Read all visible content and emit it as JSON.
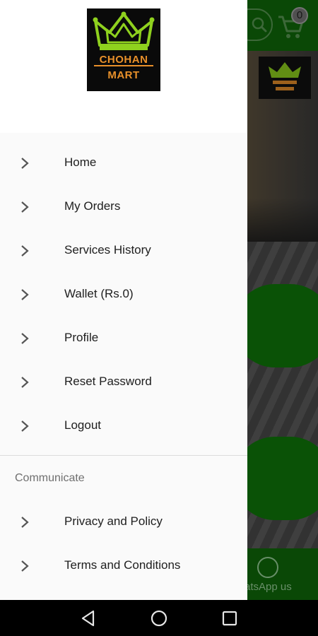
{
  "app": {
    "logo": {
      "line1": "CHOHAN",
      "line2": "MART"
    },
    "cart_count": "0"
  },
  "drawer": {
    "items": [
      {
        "label": "Home",
        "icon": "chevron-right-icon"
      },
      {
        "label": "My Orders",
        "icon": "chevron-right-icon"
      },
      {
        "label": "Services History",
        "icon": "chevron-right-icon"
      },
      {
        "label": "Wallet (Rs.0)",
        "icon": "chevron-right-icon"
      },
      {
        "label": "Profile",
        "icon": "chevron-right-icon"
      },
      {
        "label": "Reset Password",
        "icon": "chevron-right-icon"
      },
      {
        "label": "Logout",
        "icon": "chevron-right-icon"
      }
    ],
    "section_title": "Communicate",
    "communicate_items": [
      {
        "label": "Privacy and Policy",
        "icon": "chevron-right-icon"
      },
      {
        "label": "Terms and Conditions",
        "icon": "chevron-right-icon"
      }
    ]
  },
  "background": {
    "whatsapp_label": "atsApp us"
  },
  "system_nav": {
    "back_icon": "back-triangle-icon",
    "home_icon": "home-circle-icon",
    "recents_icon": "recents-square-icon"
  },
  "colors": {
    "brand_green": "#0f6b0a",
    "logo_orange": "#e8902a",
    "crown_green": "#8fd11e",
    "drawer_bg": "#fafafa"
  }
}
